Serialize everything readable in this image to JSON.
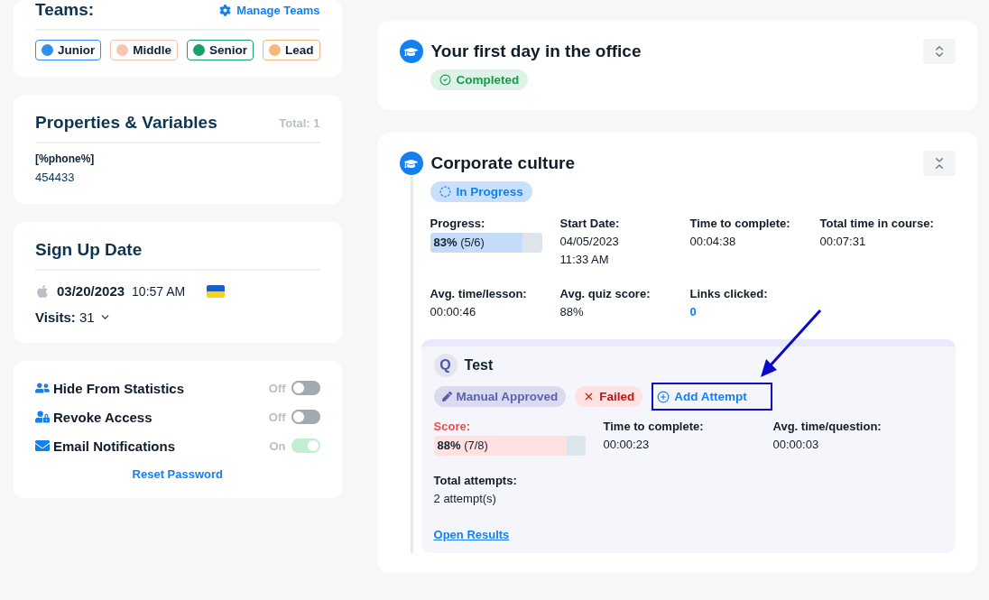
{
  "teams": {
    "title": "Teams:",
    "manage": "Manage Teams",
    "tags": [
      {
        "label": "Junior",
        "color": "#2d8ff0"
      },
      {
        "label": "Middle",
        "color": "#f9c4b0"
      },
      {
        "label": "Senior",
        "color": "#1a9e6a"
      },
      {
        "label": "Lead",
        "color": "#f6b878"
      }
    ]
  },
  "properties": {
    "title": "Properties & Variables",
    "total": "Total: 1",
    "items": [
      {
        "key": "[%phone%]",
        "value": "454433"
      }
    ]
  },
  "signup": {
    "title": "Sign Up Date",
    "date": "03/20/2023",
    "time": "10:57 AM",
    "visits_label": "Visits:",
    "visits": "31"
  },
  "settings": {
    "toggles": [
      {
        "kind": "hide",
        "label": "Hide From Statistics",
        "state_text": "Off",
        "on": false
      },
      {
        "kind": "revoke",
        "label": "Revoke Access",
        "state_text": "Off",
        "on": false
      },
      {
        "kind": "email",
        "label": "Email Notifications",
        "state_text": "On",
        "on": true
      }
    ],
    "reset": "Reset Password"
  },
  "courses": [
    {
      "title": "Your first day in the office",
      "expanded": false,
      "status": {
        "kind": "completed",
        "label": "Completed"
      }
    },
    {
      "title": "Corporate culture",
      "expanded": true,
      "status": {
        "kind": "progress",
        "label": "In Progress"
      },
      "stats": [
        {
          "kind": "bar",
          "label": "Progress:",
          "value": "**83%** (5/6)",
          "level": 0.83
        },
        {
          "kind": "text",
          "label": "Start Date:",
          "value": "04/05/2023 11:33 AM"
        },
        {
          "kind": "text",
          "label": "Time to complete:",
          "value": "00:04:38"
        },
        {
          "kind": "text",
          "label": "Total time in course:",
          "value": "00:07:31"
        },
        {
          "kind": "text",
          "label": "Avg. time/lesson:",
          "value": "00:00:46"
        },
        {
          "kind": "text",
          "label": "Avg. quiz score:",
          "value": "88%"
        },
        {
          "kind": "link",
          "label": "Links clicked:",
          "value": "0"
        }
      ],
      "quiz": {
        "badge": "Q",
        "title": "Test",
        "tags": [
          {
            "kind": "manual",
            "label": "Manual Approved"
          },
          {
            "kind": "failed",
            "label": "Failed"
          }
        ],
        "action": {
          "label": "Add Attempt",
          "highlighted": true
        },
        "stats": [
          {
            "kind": "score",
            "label": "Score:",
            "value": "**88%** (7/8)",
            "level": 0.88
          },
          {
            "kind": "text",
            "label": "Time to complete:",
            "value": "00:00:23"
          },
          {
            "kind": "text",
            "label": "Avg. time/question:",
            "value": "00:00:03"
          },
          {
            "kind": "text",
            "label": "Total attempts:",
            "value": "2 attempt(s)"
          }
        ],
        "link": "Open Results"
      }
    }
  ]
}
